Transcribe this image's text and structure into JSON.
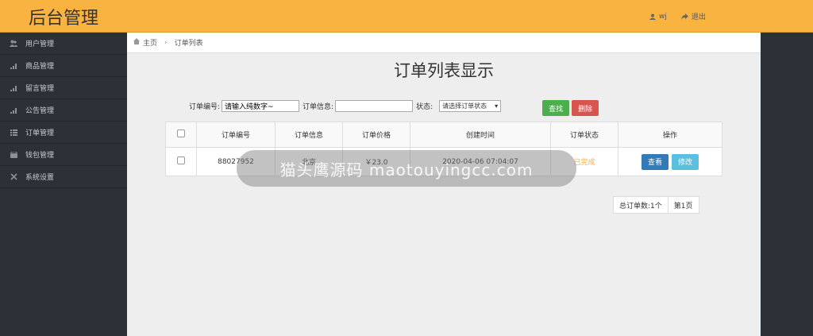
{
  "header": {
    "brand": "后台管理",
    "user": "wj",
    "logout": "退出"
  },
  "sidebar": {
    "items": [
      {
        "label": "用户管理",
        "icon": "users-icon"
      },
      {
        "label": "商品管理",
        "icon": "bar-chart-icon"
      },
      {
        "label": "留言管理",
        "icon": "bar-chart-icon"
      },
      {
        "label": "公告管理",
        "icon": "bar-chart-icon"
      },
      {
        "label": "订单管理",
        "icon": "list-icon"
      },
      {
        "label": "钱包管理",
        "icon": "wallet-icon"
      },
      {
        "label": "系统设置",
        "icon": "tools-icon"
      }
    ]
  },
  "breadcrumb": {
    "home": "主页",
    "current": "订单列表"
  },
  "page": {
    "title": "订单列表显示"
  },
  "filters": {
    "order_no_label": "订单编号:",
    "order_no_value": "请输入纯数字~",
    "order_info_label": "订单信息:",
    "order_info_value": "",
    "status_label": "状态:",
    "status_selected": "请选择订单状态",
    "search_button": "查找",
    "delete_button": "删除"
  },
  "table": {
    "headers": [
      "",
      "订单编号",
      "订单信息",
      "订单价格",
      "创建时间",
      "订单状态",
      "操作"
    ],
    "rows": [
      {
        "order_no": "88027952",
        "info": "北京",
        "price": "￥23.0",
        "created": "2020-04-06 07:04:07",
        "status": "已完成",
        "view": "查看",
        "edit": "修改"
      }
    ]
  },
  "pager": {
    "total": "总订单数:1个",
    "page": "第1页"
  },
  "watermark": {
    "text": "猫头鹰源码 maotouyingcc.com"
  },
  "colors": {
    "topbar": "#f8b340",
    "sidebar": "#2b3137",
    "search": "#4cae4c",
    "delete": "#d9534f",
    "view": "#337ab7",
    "edit": "#5bc0de",
    "status_done": "#f0ad4e"
  }
}
